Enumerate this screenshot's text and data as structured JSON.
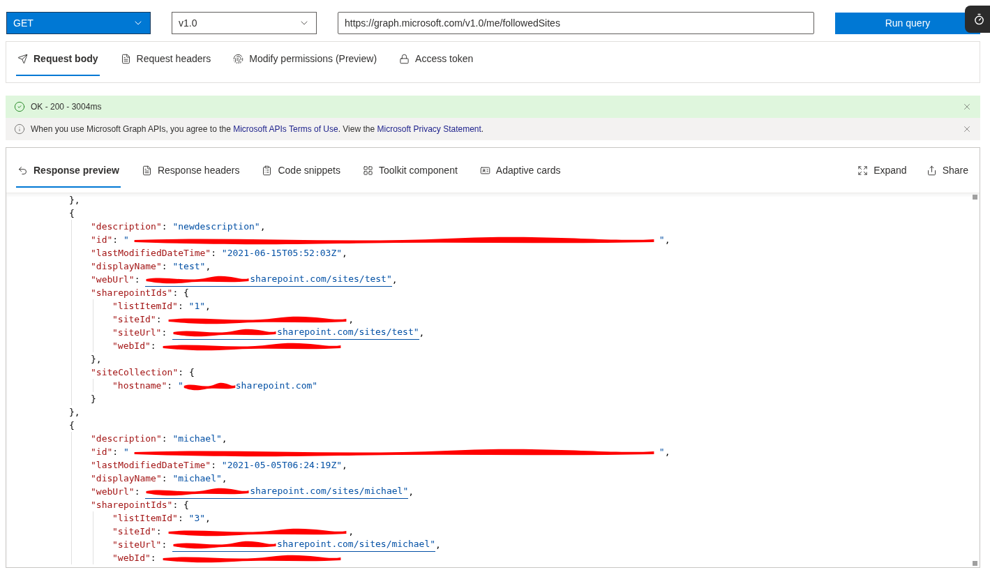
{
  "query_bar": {
    "method": "GET",
    "version": "v1.0",
    "url": "https://graph.microsoft.com/v1.0/me/followedSites",
    "run_button": "Run query"
  },
  "request_tabs": [
    {
      "label": "Request body",
      "selected": true
    },
    {
      "label": "Request headers",
      "selected": false
    },
    {
      "label": "Modify permissions (Preview)",
      "selected": false
    },
    {
      "label": "Access token",
      "selected": false
    }
  ],
  "status": {
    "text": "OK - 200 - 3004ms"
  },
  "notice": {
    "parts": [
      {
        "kind": "text",
        "text": "When you use Microsoft Graph APIs, you agree to the "
      },
      {
        "kind": "link",
        "text": "Microsoft APIs Terms of Use"
      },
      {
        "kind": "text",
        "text": ". View the "
      },
      {
        "kind": "link",
        "text": "Microsoft Privacy Statement"
      },
      {
        "kind": "text",
        "text": "."
      }
    ]
  },
  "response_tabs": [
    {
      "label": "Response preview",
      "selected": true
    },
    {
      "label": "Response headers",
      "selected": false
    },
    {
      "label": "Code snippets",
      "selected": false
    },
    {
      "label": "Toolkit component",
      "selected": false
    },
    {
      "label": "Adaptive cards",
      "selected": false
    }
  ],
  "response_actions": [
    {
      "label": "Expand"
    },
    {
      "label": "Share"
    }
  ],
  "response_lines": [
    {
      "tokens": [
        {
          "kind": "punct",
          "text": "},"
        }
      ]
    },
    {
      "tokens": [
        {
          "kind": "punct",
          "text": "{"
        }
      ],
      "children": [
        {
          "tokens": [
            {
              "kind": "key",
              "text": "\"description\""
            },
            {
              "kind": "punct",
              "text": ": "
            },
            {
              "kind": "string",
              "text": "\"newdescription\""
            },
            {
              "kind": "punct",
              "text": ","
            }
          ]
        },
        {
          "tokens": [
            {
              "kind": "key",
              "text": "\"id\""
            },
            {
              "kind": "punct",
              "text": ": "
            },
            {
              "kind": "string",
              "text": "\""
            },
            {
              "kind": "redacted"
            },
            {
              "kind": "string",
              "text": "\""
            },
            {
              "kind": "punct",
              "text": ","
            }
          ]
        },
        {
          "tokens": [
            {
              "kind": "key",
              "text": "\"lastModifiedDateTime\""
            },
            {
              "kind": "punct",
              "text": ": "
            },
            {
              "kind": "string",
              "text": "\"2021-06-15T05:52:03Z\""
            },
            {
              "kind": "punct",
              "text": ","
            }
          ]
        },
        {
          "tokens": [
            {
              "kind": "key",
              "text": "\"displayName\""
            },
            {
              "kind": "punct",
              "text": ": "
            },
            {
              "kind": "string",
              "text": "\"test\""
            },
            {
              "kind": "punct",
              "text": ","
            }
          ]
        },
        {
          "tokens": [
            {
              "kind": "key",
              "text": "\"webUrl\""
            },
            {
              "kind": "punct",
              "text": ": "
            },
            {
              "kind": "link",
              "text": "sharepoint.com/sites/test\"",
              "redacted": true
            },
            {
              "kind": "punct",
              "text": ","
            }
          ]
        },
        {
          "tokens": [
            {
              "kind": "key",
              "text": "\"sharepointIds\""
            },
            {
              "kind": "punct",
              "text": ": {"
            }
          ],
          "children": [
            {
              "tokens": [
                {
                  "kind": "key",
                  "text": "\"listItemId\""
                },
                {
                  "kind": "punct",
                  "text": ": "
                },
                {
                  "kind": "string",
                  "text": "\"1\""
                },
                {
                  "kind": "punct",
                  "text": ","
                }
              ]
            },
            {
              "tokens": [
                {
                  "kind": "key",
                  "text": "\"siteId\""
                },
                {
                  "kind": "punct",
                  "text": ": "
                },
                {
                  "kind": "redacted"
                },
                {
                  "kind": "punct",
                  "text": ","
                }
              ]
            },
            {
              "tokens": [
                {
                  "kind": "key",
                  "text": "\"siteUrl\""
                },
                {
                  "kind": "punct",
                  "text": ": "
                },
                {
                  "kind": "link",
                  "text": "sharepoint.com/sites/test\"",
                  "redacted": true
                },
                {
                  "kind": "punct",
                  "text": ","
                }
              ]
            },
            {
              "tokens": [
                {
                  "kind": "key",
                  "text": "\"webId\""
                },
                {
                  "kind": "punct",
                  "text": ": "
                },
                {
                  "kind": "redacted"
                }
              ]
            }
          ]
        },
        {
          "tokens": [
            {
              "kind": "punct",
              "text": "},"
            }
          ]
        },
        {
          "tokens": [
            {
              "kind": "key",
              "text": "\"siteCollection\""
            },
            {
              "kind": "punct",
              "text": ": {"
            }
          ],
          "children": [
            {
              "tokens": [
                {
                  "kind": "key",
                  "text": "\"hostname\""
                },
                {
                  "kind": "punct",
                  "text": ": "
                },
                {
                  "kind": "string",
                  "text": "\""
                },
                {
                  "kind": "string",
                  "text": "sharepoint.com\"",
                  "redacted": true
                }
              ]
            }
          ]
        },
        {
          "tokens": [
            {
              "kind": "punct",
              "text": "}"
            }
          ]
        }
      ]
    },
    {
      "tokens": [
        {
          "kind": "punct",
          "text": "},"
        }
      ]
    },
    {
      "tokens": [
        {
          "kind": "punct",
          "text": "{"
        }
      ],
      "children": [
        {
          "tokens": [
            {
              "kind": "key",
              "text": "\"description\""
            },
            {
              "kind": "punct",
              "text": ": "
            },
            {
              "kind": "string",
              "text": "\"michael\""
            },
            {
              "kind": "punct",
              "text": ","
            }
          ]
        },
        {
          "tokens": [
            {
              "kind": "key",
              "text": "\"id\""
            },
            {
              "kind": "punct",
              "text": ": "
            },
            {
              "kind": "string",
              "text": "\""
            },
            {
              "kind": "redacted"
            },
            {
              "kind": "string",
              "text": "\""
            },
            {
              "kind": "punct",
              "text": ","
            }
          ]
        },
        {
          "tokens": [
            {
              "kind": "key",
              "text": "\"lastModifiedDateTime\""
            },
            {
              "kind": "punct",
              "text": ": "
            },
            {
              "kind": "string",
              "text": "\"2021-05-05T06:24:19Z\""
            },
            {
              "kind": "punct",
              "text": ","
            }
          ]
        },
        {
          "tokens": [
            {
              "kind": "key",
              "text": "\"displayName\""
            },
            {
              "kind": "punct",
              "text": ": "
            },
            {
              "kind": "string",
              "text": "\"michael\""
            },
            {
              "kind": "punct",
              "text": ","
            }
          ]
        },
        {
          "tokens": [
            {
              "kind": "key",
              "text": "\"webUrl\""
            },
            {
              "kind": "punct",
              "text": ": "
            },
            {
              "kind": "link",
              "text": "sharepoint.com/sites/michael\"",
              "redacted": true
            },
            {
              "kind": "punct",
              "text": ","
            }
          ]
        },
        {
          "tokens": [
            {
              "kind": "key",
              "text": "\"sharepointIds\""
            },
            {
              "kind": "punct",
              "text": ": {"
            }
          ],
          "children": [
            {
              "tokens": [
                {
                  "kind": "key",
                  "text": "\"listItemId\""
                },
                {
                  "kind": "punct",
                  "text": ": "
                },
                {
                  "kind": "string",
                  "text": "\"3\""
                },
                {
                  "kind": "punct",
                  "text": ","
                }
              ]
            },
            {
              "tokens": [
                {
                  "kind": "key",
                  "text": "\"siteId\""
                },
                {
                  "kind": "punct",
                  "text": ": "
                },
                {
                  "kind": "redacted"
                },
                {
                  "kind": "punct",
                  "text": ","
                }
              ]
            },
            {
              "tokens": [
                {
                  "kind": "key",
                  "text": "\"siteUrl\""
                },
                {
                  "kind": "punct",
                  "text": ": "
                },
                {
                  "kind": "link",
                  "text": "sharepoint.com/sites/michael\"",
                  "redacted": true
                },
                {
                  "kind": "punct",
                  "text": ","
                }
              ]
            },
            {
              "tokens": [
                {
                  "kind": "key",
                  "text": "\"webId\""
                },
                {
                  "kind": "punct",
                  "text": ": "
                },
                {
                  "kind": "redacted"
                }
              ]
            }
          ]
        }
      ]
    }
  ]
}
